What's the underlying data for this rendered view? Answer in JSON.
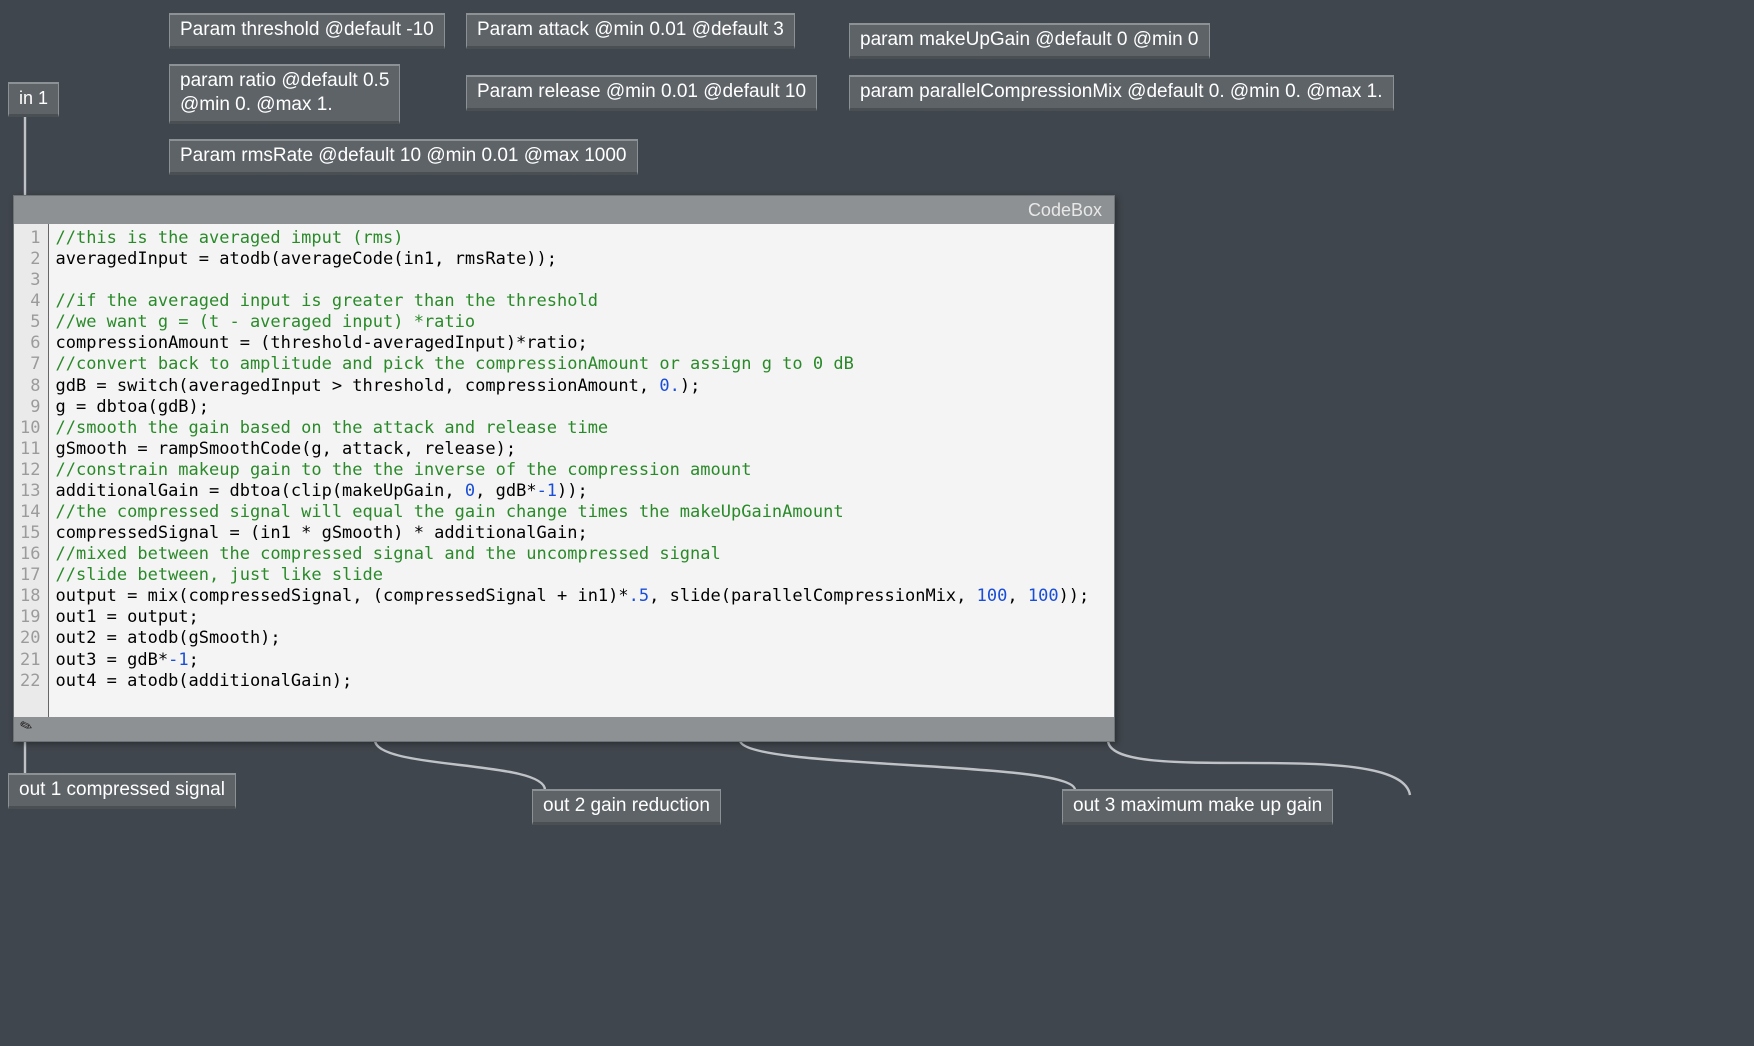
{
  "nodes": {
    "in1": "in 1",
    "p_threshold": "Param threshold @default -10",
    "p_attack": "Param attack @min 0.01 @default 3",
    "p_makeUpGain": "param makeUpGain @default 0 @min 0",
    "p_ratio": "param ratio @default 0.5\n@min 0. @max 1.",
    "p_release": "Param release @min 0.01 @default 10",
    "p_parallel": "param parallelCompressionMix @default 0. @min 0. @max 1.",
    "p_rmsRate": "Param rmsRate @default 10 @min 0.01 @max 1000",
    "out1": "out 1 compressed signal",
    "out2": "out 2 gain reduction",
    "out3": "out 3 maximum make up gain"
  },
  "codebox": {
    "title": "CodeBox"
  },
  "code": {
    "l1": "//this is the averaged imput (rms)",
    "l2a": "averagedInput = atodb(averageCode(in1, rmsRate));",
    "l4": "//if the averaged input is greater than the threshold",
    "l5": "//we want g = (t - averaged input) *ratio",
    "l6": "compressionAmount = (threshold-averagedInput)*ratio;",
    "l7": "//convert back to amplitude and pick the compressionAmount or assign g to 0 dB",
    "l8a": "gdB = switch(averagedInput > threshold, compressionAmount, ",
    "l8b": "0.",
    "l8c": ");",
    "l9": "g = dbtoa(gdB);",
    "l10": "//smooth the gain based on the attack and release time",
    "l11": "gSmooth = rampSmoothCode(g, attack, release);",
    "l12": "//constrain makeup gain to the the inverse of the compression amount",
    "l13a": "additionalGain = dbtoa(clip(makeUpGain, ",
    "l13b": "0",
    "l13c": ", gdB*",
    "l13d": "-1",
    "l13e": "));",
    "l14": "//the compressed signal will equal the gain change times the makeUpGainAmount",
    "l15": "compressedSignal = (in1 * gSmooth) * additionalGain;",
    "l16": "//mixed between the compressed signal and the uncompressed signal",
    "l17": "//slide between, just like slide",
    "l18a": "output = mix(compressedSignal, (compressedSignal + in1)*",
    "l18b": ".5",
    "l18c": ", slide(parallelCompressionMix, ",
    "l18d": "100",
    "l18e": ", ",
    "l18f": "100",
    "l18g": "));",
    "l19": "out1 = output;",
    "l20": "out2 = atodb(gSmooth);",
    "l21a": "out3 = gdB*",
    "l21b": "-1",
    "l21c": ";",
    "l22": "out4 = atodb(additionalGain);"
  },
  "lineNumbers": [
    "1",
    "2",
    "3",
    "4",
    "5",
    "6",
    "7",
    "8",
    "9",
    "10",
    "11",
    "12",
    "13",
    "14",
    "15",
    "16",
    "17",
    "18",
    "19",
    "20",
    "21",
    "22"
  ]
}
